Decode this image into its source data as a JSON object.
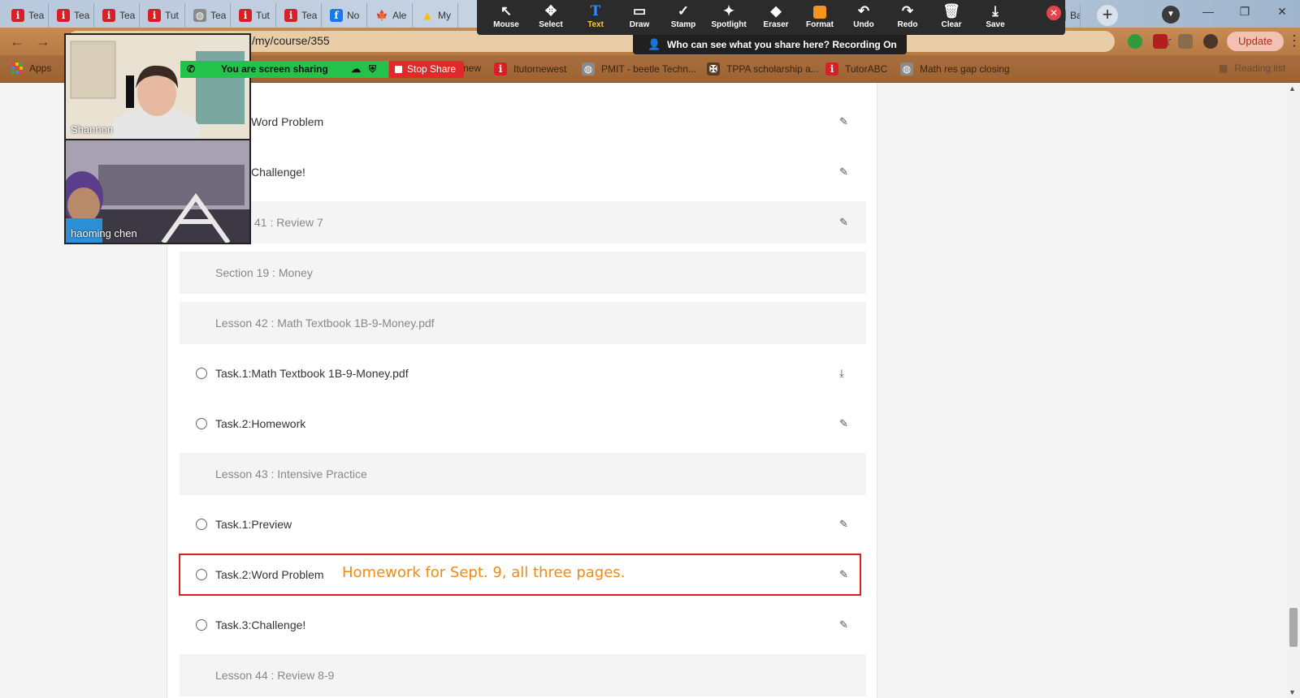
{
  "tabs": [
    {
      "label": "Tea",
      "icon": "itutor-icon"
    },
    {
      "label": "Tea",
      "icon": "itutor-icon"
    },
    {
      "label": "Tea",
      "icon": "itutor-icon"
    },
    {
      "label": "Tut",
      "icon": "itutor-icon"
    },
    {
      "label": "Tea",
      "icon": "globe-icon"
    },
    {
      "label": "Tut",
      "icon": "itutor-icon"
    },
    {
      "label": "Tea",
      "icon": "itutor-icon"
    },
    {
      "label": "No",
      "icon": "facebook-icon"
    },
    {
      "label": "Ale",
      "icon": "maple-leaf-icon"
    },
    {
      "label": "My",
      "icon": "google-drive-icon"
    },
    {
      "label": "Ba",
      "icon": "sheets-icon"
    }
  ],
  "address_bar": {
    "url": "/my/course/355",
    "update_label": "Update"
  },
  "bookmarks": [
    {
      "label": "Apps",
      "icon": "apps-grid-icon"
    },
    {
      "label": "new",
      "icon": "none"
    },
    {
      "label": "Itutornewest",
      "icon": "itutor-icon"
    },
    {
      "label": "PMIT - beetle Techn...",
      "icon": "globe-icon"
    },
    {
      "label": "TPPA scholarship a...",
      "icon": "crest-icon"
    },
    {
      "label": "TutorABC",
      "icon": "itutor-icon"
    },
    {
      "label": "Math res gap closing",
      "icon": "globe-icon"
    }
  ],
  "reading_list": "Reading list",
  "zoom_toolbar": {
    "tools": [
      {
        "label": "Mouse",
        "icon": "↖"
      },
      {
        "label": "Select",
        "icon": "✥"
      },
      {
        "label": "Text",
        "icon": "T"
      },
      {
        "label": "Draw",
        "icon": "▭"
      },
      {
        "label": "Stamp",
        "icon": "✓"
      },
      {
        "label": "Spotlight",
        "icon": "✦"
      },
      {
        "label": "Eraser",
        "icon": "◆"
      },
      {
        "label": "Format",
        "icon": "■"
      },
      {
        "label": "Undo",
        "icon": "↶"
      },
      {
        "label": "Redo",
        "icon": "↷"
      },
      {
        "label": "Clear",
        "icon": "🗑"
      },
      {
        "label": "Save",
        "icon": "⤓"
      }
    ],
    "active_tool": "Text",
    "format_color": "#f7941d"
  },
  "share_banner": "Who can see what you share here? Recording On",
  "sharing_status": "You are screen sharing",
  "stop_share_label": "Stop Share",
  "participants": [
    {
      "name": "Shannon"
    },
    {
      "name": "haoming   chen"
    }
  ],
  "course": {
    "rows": [
      {
        "type": "task",
        "label": "Word Problem",
        "action": "edit",
        "radio": false
      },
      {
        "type": "task",
        "label": "Challenge!",
        "action": "edit",
        "radio": false
      },
      {
        "type": "header",
        "label": "41 : Review 7",
        "action": "edit"
      },
      {
        "type": "header",
        "label": "Section 19 : Money",
        "action": "none"
      },
      {
        "type": "header",
        "label": "Lesson 42 : Math Textbook 1B-9-Money.pdf",
        "action": "none"
      },
      {
        "type": "task",
        "label": "Task.1:Math Textbook 1B-9-Money.pdf",
        "action": "download",
        "radio": true
      },
      {
        "type": "task",
        "label": "Task.2:Homework",
        "action": "edit",
        "radio": true
      },
      {
        "type": "header",
        "label": "Lesson 43 : Intensive Practice",
        "action": "none"
      },
      {
        "type": "task",
        "label": "Task.1:Preview",
        "action": "edit",
        "radio": true
      },
      {
        "type": "task",
        "label": "Task.2:Word Problem",
        "action": "edit",
        "radio": true
      },
      {
        "type": "task",
        "label": "Task.3:Challenge!",
        "action": "edit",
        "radio": true
      },
      {
        "type": "header",
        "label": "Lesson 44 : Review 8-9",
        "action": "none"
      }
    ]
  },
  "annotation": {
    "text": "Homework for Sept. 9, all three pages.",
    "color": "#f08a16",
    "box_color": "#e22020"
  },
  "scroll_position": 0.93
}
